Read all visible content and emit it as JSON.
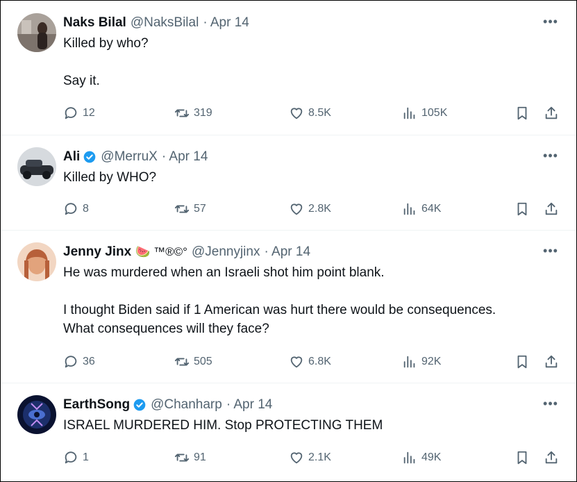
{
  "tweets": [
    {
      "name": "Naks Bilal",
      "handle": "@NaksBilal",
      "date": "· Apr 14",
      "text": "Killed by who?\n\nSay it.",
      "replies": "12",
      "retweets": "319",
      "likes": "8.5K",
      "views": "105K",
      "verified": false,
      "avatar_colors": [
        "#9a8f88",
        "#5a4a44"
      ]
    },
    {
      "name": "Ali",
      "handle": "@MerruX",
      "date": "· Apr 14",
      "text": "Killed by WHO?",
      "replies": "8",
      "retweets": "57",
      "likes": "2.8K",
      "views": "64K",
      "verified": true,
      "avatar_colors": [
        "#c9ced3",
        "#2b2f36"
      ]
    },
    {
      "name": "Jenny Jinx",
      "emoji": "🍉 ™®©°",
      "handle": "@Jennyjinx",
      "date": "· Apr 14",
      "text": "He was murdered when an Israeli shot him point blank.\n\nI thought Biden said if 1 American was hurt there would be consequences.\nWhat consequences will they face?",
      "replies": "36",
      "retweets": "505",
      "likes": "6.8K",
      "views": "92K",
      "verified": false,
      "avatar_colors": [
        "#e8b48a",
        "#b7603a"
      ]
    },
    {
      "name": "EarthSong",
      "handle": "@Chanharp",
      "date": "· Apr 14",
      "text": "ISRAEL MURDERED HIM. Stop PROTECTING THEM",
      "replies": "1",
      "retweets": "91",
      "likes": "2.1K",
      "views": "49K",
      "verified": true,
      "avatar_colors": [
        "#1c2f6b",
        "#0a1230"
      ]
    }
  ],
  "icons": {
    "more": "more-icon",
    "reply": "reply-icon",
    "retweet": "retweet-icon",
    "like": "heart-icon",
    "views": "views-icon",
    "bookmark": "bookmark-icon",
    "share": "share-icon",
    "verified": "verified-badge-icon"
  },
  "colors": {
    "text": "#0f1419",
    "muted": "#536471",
    "verified": "#1d9bf0",
    "divider": "#eff3f4"
  }
}
